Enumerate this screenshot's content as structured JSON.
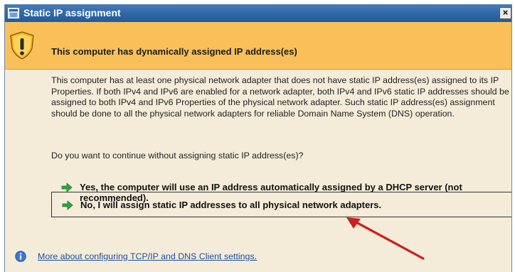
{
  "window": {
    "title": "Static IP assignment",
    "close_label": "×"
  },
  "banner": {
    "heading": "This computer has dynamically assigned IP address(es)",
    "icon": "warning-shield-icon"
  },
  "content": {
    "description": "This computer has at least one physical network adapter that does not have static IP address(es) assigned to its IP Properties. If both IPv4 and IPv6 are enabled for a network adapter, both IPv4 and IPv6 static IP addresses should be assigned to both IPv4 and IPv6 Properties of the physical network adapter. Such static IP address(es) assignment should be done to all the physical network adapters for reliable Domain Name System (DNS) operation.",
    "question": "Do you want to continue without assigning static IP address(es)?"
  },
  "options": {
    "yes": {
      "label": "Yes, the computer will use an IP address automatically assigned by a DHCP server (not recommended).",
      "icon": "green-arrow-icon"
    },
    "no": {
      "label": "No, I will assign static IP addresses to all physical network adapters.",
      "icon": "green-arrow-icon"
    }
  },
  "footer": {
    "link_text": "More about configuring TCP/IP and DNS Client settings.",
    "icon": "info-icon"
  },
  "colors": {
    "titlebar": "#2f66a8",
    "banner": "#f9c05a",
    "background": "#f4ecd9",
    "link": "#1f4fa0",
    "arrow": "#2ca53a",
    "annotation": "#cc1f1f"
  }
}
